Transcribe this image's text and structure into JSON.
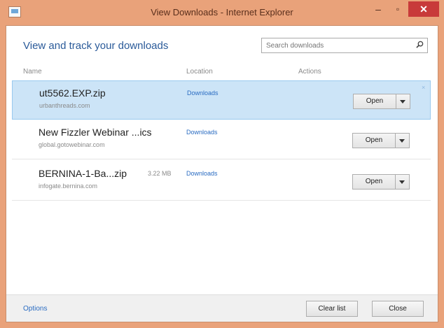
{
  "window": {
    "title": "View Downloads - Internet Explorer",
    "minimize": "–",
    "maximize": "▫",
    "close": "✕",
    "colors": {
      "frame": "#e9a27a",
      "close": "#c83a3a",
      "accent": "#2a5a99",
      "link": "#2a6cc2",
      "selected": "#cce4f7"
    }
  },
  "header": {
    "title": "View and track your downloads",
    "search_placeholder": "Search downloads",
    "search_icon": "search-icon"
  },
  "columns": {
    "name": "Name",
    "location": "Location",
    "actions": "Actions"
  },
  "downloads": [
    {
      "name": "ut5562.EXP.zip",
      "size": "",
      "source": "urbanthreads.com",
      "location": "Downloads",
      "action": "Open",
      "selected": true
    },
    {
      "name": "New Fizzler Webinar ...ics",
      "size": "",
      "source": "global.gotowebinar.com",
      "location": "Downloads",
      "action": "Open",
      "selected": false
    },
    {
      "name": "BERNINA-1-Ba...zip",
      "size": "3.22 MB",
      "source": "infogate.bernina.com",
      "location": "Downloads",
      "action": "Open",
      "selected": false
    }
  ],
  "remove_icon": "×",
  "footer": {
    "options": "Options",
    "clear_list": "Clear list",
    "close": "Close"
  }
}
